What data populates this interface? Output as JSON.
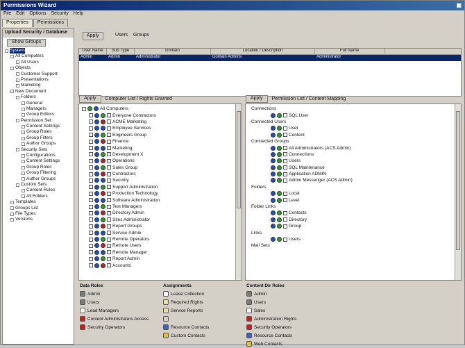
{
  "window": {
    "title": "Permissions Wizard",
    "controls": "▣"
  },
  "menu": [
    "File",
    "Edit",
    "Options",
    "Security",
    "Help"
  ],
  "top_tabs": [
    "Properties",
    "Permissions"
  ],
  "left": {
    "header": "Upload Security / Database",
    "button": "Show Groups",
    "tree": [
      {
        "label": "System",
        "indent": 0,
        "sel": true
      },
      {
        "label": "All Computers",
        "indent": 1
      },
      {
        "label": "All Users",
        "indent": 2
      },
      {
        "label": "Objects",
        "indent": 1
      },
      {
        "label": "Customer Support",
        "indent": 2
      },
      {
        "label": "Presentations",
        "indent": 2
      },
      {
        "label": "Marketing",
        "indent": 2
      },
      {
        "label": "New Document",
        "indent": 1
      },
      {
        "label": "Folders",
        "indent": 2
      },
      {
        "label": "General",
        "indent": 3
      },
      {
        "label": "Managers",
        "indent": 3
      },
      {
        "label": "Group Editors",
        "indent": 3
      },
      {
        "label": "Permission Set",
        "indent": 2
      },
      {
        "label": "Content Settings",
        "indent": 3
      },
      {
        "label": "Group Roles",
        "indent": 3
      },
      {
        "label": "Group Filters",
        "indent": 3
      },
      {
        "label": "Author Groups",
        "indent": 3
      },
      {
        "label": "Security Sets",
        "indent": 2
      },
      {
        "label": "Configurations",
        "indent": 3
      },
      {
        "label": "Content Settings",
        "indent": 3
      },
      {
        "label": "Group Roles",
        "indent": 3
      },
      {
        "label": "Group Filtering",
        "indent": 3
      },
      {
        "label": "Author Groups",
        "indent": 3
      },
      {
        "label": "Custom Sets",
        "indent": 2
      },
      {
        "label": "Content Rules",
        "indent": 3
      },
      {
        "label": "All Folders",
        "indent": 3
      },
      {
        "label": "Templates",
        "indent": 1
      },
      {
        "label": "Groups List",
        "indent": 1
      },
      {
        "label": "File Types",
        "indent": 1
      },
      {
        "label": "Versions",
        "indent": 1
      }
    ]
  },
  "top": {
    "apply_button": "Apply",
    "view": "Users",
    "filter": "Groups",
    "columns": [
      "User Name",
      "Sub Type",
      "Domain",
      "Location / Description",
      "Full Name"
    ],
    "row": [
      "Admin",
      "Admin",
      "Administrator",
      "Domain Admins",
      "Administrator"
    ]
  },
  "mid_left": {
    "button": "Apply",
    "title": "Computer List / Rights Granted",
    "root": "All Computers",
    "rows": [
      "Everyone Contractors",
      "ACME Marketing",
      "Employee Services",
      "Engineers Group",
      "Finance",
      "Marketing",
      "Development X",
      "Operations",
      "Sales Group",
      "Contractors",
      "Security",
      "Support Administration",
      "Production Technology",
      "Software Administration",
      "Test Managers",
      "Directory Admin",
      "Sites Administrator",
      "Report Groups",
      "Service Admin",
      "Remote Operators",
      "Remote Users",
      "Remote Manager",
      "Report Admin",
      "Accounts"
    ]
  },
  "mid_right": {
    "button": "Apply",
    "title": "Permission List / Content Mapping",
    "rows": [
      {
        "label": "Connections",
        "lvl": 0
      },
      {
        "label": "SQL User",
        "lvl": 2
      },
      {
        "label": "Connected Users",
        "lvl": 0
      },
      {
        "label": "User",
        "lvl": 2
      },
      {
        "label": "Content",
        "lvl": 2
      },
      {
        "label": "Connected Groups",
        "lvl": 0
      },
      {
        "label": "All Administrators (ACS Admin)",
        "lvl": 2
      },
      {
        "label": "Connections",
        "lvl": 2
      },
      {
        "label": "Users",
        "lvl": 2
      },
      {
        "label": "SQL Maintenance",
        "lvl": 2
      },
      {
        "label": "Application ADMIN",
        "lvl": 2
      },
      {
        "label": "Admin Messenger (ACS Admin)",
        "lvl": 2
      },
      {
        "label": "Folders",
        "lvl": 0
      },
      {
        "label": "Local",
        "lvl": 2
      },
      {
        "label": "Level",
        "lvl": 2
      },
      {
        "label": "Folder Links",
        "lvl": 0
      },
      {
        "label": "Contacts",
        "lvl": 2
      },
      {
        "label": "Directory",
        "lvl": 2
      },
      {
        "label": "Group",
        "lvl": 2
      },
      {
        "label": "Links",
        "lvl": 0
      },
      {
        "label": "Users",
        "lvl": 2
      },
      {
        "label": "Mail Sets",
        "lvl": 0
      }
    ]
  },
  "legend_left": {
    "title": "Data Roles",
    "items": [
      {
        "label": "Admin",
        "color": "#7a7a7a"
      },
      {
        "label": "Users",
        "color": "#7a7a7a"
      },
      {
        "label": "Lead Managers",
        "color": "#ffffff"
      },
      {
        "label": "Content Administrators Access",
        "color": "#c02020"
      },
      {
        "label": "Security Operators",
        "color": "#c02020"
      }
    ]
  },
  "legend_mid": {
    "title": "Assignments",
    "items": [
      {
        "label": "Lease Collection",
        "color": "#ffffff"
      },
      {
        "label": "Required Rights",
        "color": "#e8e0a0"
      },
      {
        "label": "Service Reports",
        "color": "#e8e0a0"
      },
      {
        "label": "",
        "color": "#d4d0c8"
      },
      {
        "label": "Resource Contacts",
        "color": "#4060c0"
      },
      {
        "label": "Custom Contacts",
        "color": "#e0c040"
      }
    ]
  },
  "legend_right": {
    "title": "Content Dir Roles",
    "items": [
      {
        "label": "Admin",
        "color": "#7a7a7a"
      },
      {
        "label": "Users",
        "color": "#7a7a7a"
      },
      {
        "label": "Sales",
        "color": "#ffffff"
      },
      {
        "label": "Administration Rights",
        "color": "#c02020"
      },
      {
        "label": "Security Operators",
        "color": "#c02020"
      },
      {
        "label": "Resource Contacts",
        "color": "#4060c0"
      },
      {
        "label": "Web Contacts",
        "color": "#e0c040"
      }
    ]
  }
}
